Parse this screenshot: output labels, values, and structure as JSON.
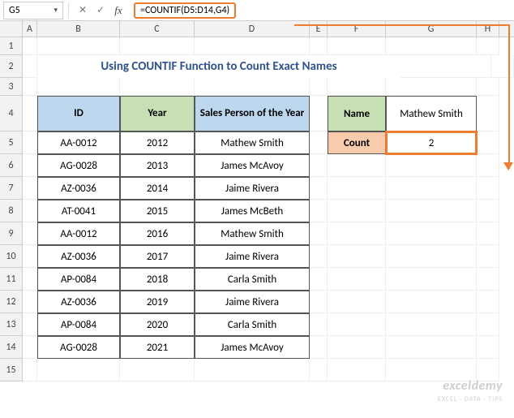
{
  "namebox": "G5",
  "formula": "=COUNTIF(D5:D14,G4)",
  "title": "Using COUNTIF Function to Count Exact Names",
  "columns": [
    "A",
    "B",
    "C",
    "D",
    "E",
    "F",
    "G",
    "H"
  ],
  "row_numbers": [
    "1",
    "2",
    "3",
    "4",
    "5",
    "6",
    "7",
    "8",
    "9",
    "10",
    "11",
    "12",
    "13",
    "14",
    "15"
  ],
  "headers": {
    "id": "ID",
    "year": "Year",
    "sp": "Sales Person of the Year"
  },
  "data": [
    {
      "id": "AA-0012",
      "year": "2012",
      "sp": "Mathew Smith"
    },
    {
      "id": "AG-0028",
      "year": "2013",
      "sp": "James McAvoy"
    },
    {
      "id": "AZ-0036",
      "year": "2014",
      "sp": "Jaime Rivera"
    },
    {
      "id": "AT-0041",
      "year": "2015",
      "sp": "James McBeth"
    },
    {
      "id": "AA-0012",
      "year": "2016",
      "sp": "Mathew Smith"
    },
    {
      "id": "AZ-0036",
      "year": "2017",
      "sp": "Jaime Rivera"
    },
    {
      "id": "AP-0084",
      "year": "2018",
      "sp": "Carla Smith"
    },
    {
      "id": "AZ-0036",
      "year": "2019",
      "sp": "Jaime Rivera"
    },
    {
      "id": "AP-0084",
      "year": "2020",
      "sp": "Carla Smith"
    },
    {
      "id": "AG-0028",
      "year": "2021",
      "sp": "James McAvoy"
    }
  ],
  "side": {
    "name_label": "Name",
    "name_value": "Mathew Smith",
    "count_label": "Count",
    "count_value": "2"
  },
  "watermark": {
    "brand": "exceldemy",
    "tag": "EXCEL · DATA · TIPS"
  },
  "fb_icons": {
    "cancel": "✕",
    "confirm": "✓",
    "fx": "fx"
  }
}
